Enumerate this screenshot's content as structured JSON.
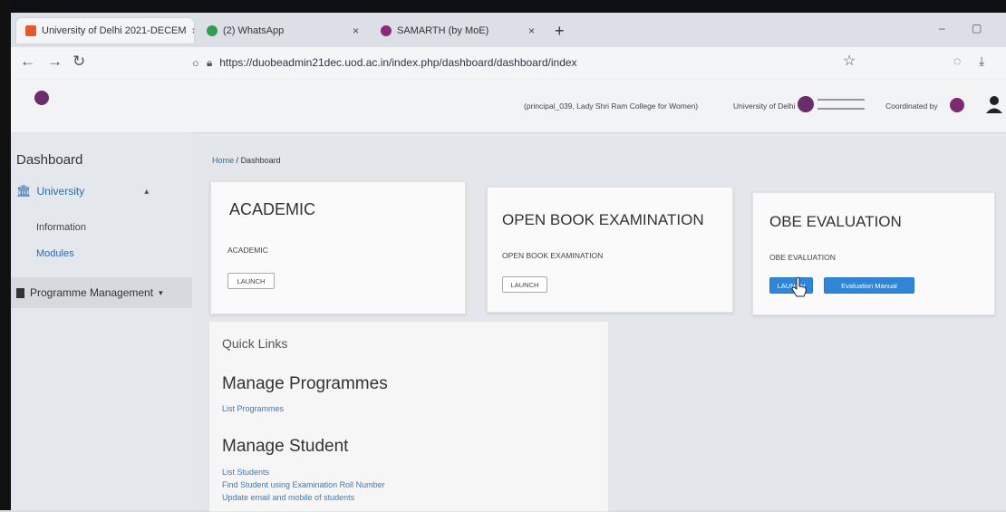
{
  "browser": {
    "tabs": [
      {
        "label": "University of Delhi 2021-DECEM",
        "close": "×",
        "favicon_color": "#e05a2b"
      },
      {
        "label": "(2) WhatsApp",
        "close": "×",
        "favicon_color": "#2e9e4f"
      },
      {
        "label": "SAMARTH (by MoE)",
        "close": "×",
        "favicon_color": "#8b2a7a"
      }
    ],
    "new_tab": "+",
    "url": "https://duobeadmin21dec.uod.ac.in/index.php/dashboard/dashboard/index"
  },
  "header": {
    "user_info": "(principal_039, Lady Shri Ram College for Women)",
    "university": "University of Delhi",
    "coordinated_by": "Coordinated by"
  },
  "sidebar": {
    "title": "Dashboard",
    "university": "University",
    "items": [
      "Information",
      "Modules"
    ],
    "programme": "Programme Management"
  },
  "breadcrumb": {
    "home": "Home",
    "sep": "/",
    "current": "Dashboard"
  },
  "cards": [
    {
      "title": "ACADEMIC",
      "subtitle": "ACADEMIC",
      "button": "LAUNCH"
    },
    {
      "title": "OPEN BOOK EXAMINATION",
      "subtitle": "OPEN BOOK EXAMINATION",
      "button": "LAUNCH"
    },
    {
      "title": "OBE EVALUATION",
      "subtitle": "OBE EVALUATION",
      "button": "LAUNCH",
      "button2": "Evaluation Manual"
    }
  ],
  "quick_links": {
    "title": "Quick Links",
    "sections": [
      {
        "heading": "Manage Programmes",
        "links": [
          "List Programmes"
        ]
      },
      {
        "heading": "Manage Student",
        "links": [
          "List Students",
          "Find Student using Examination Roll Number",
          "Update email and mobile of students"
        ]
      }
    ]
  },
  "colors": {
    "link": "#2b6cb0",
    "primary_button": "#2f86d8",
    "brand": "#6b2c6e"
  }
}
